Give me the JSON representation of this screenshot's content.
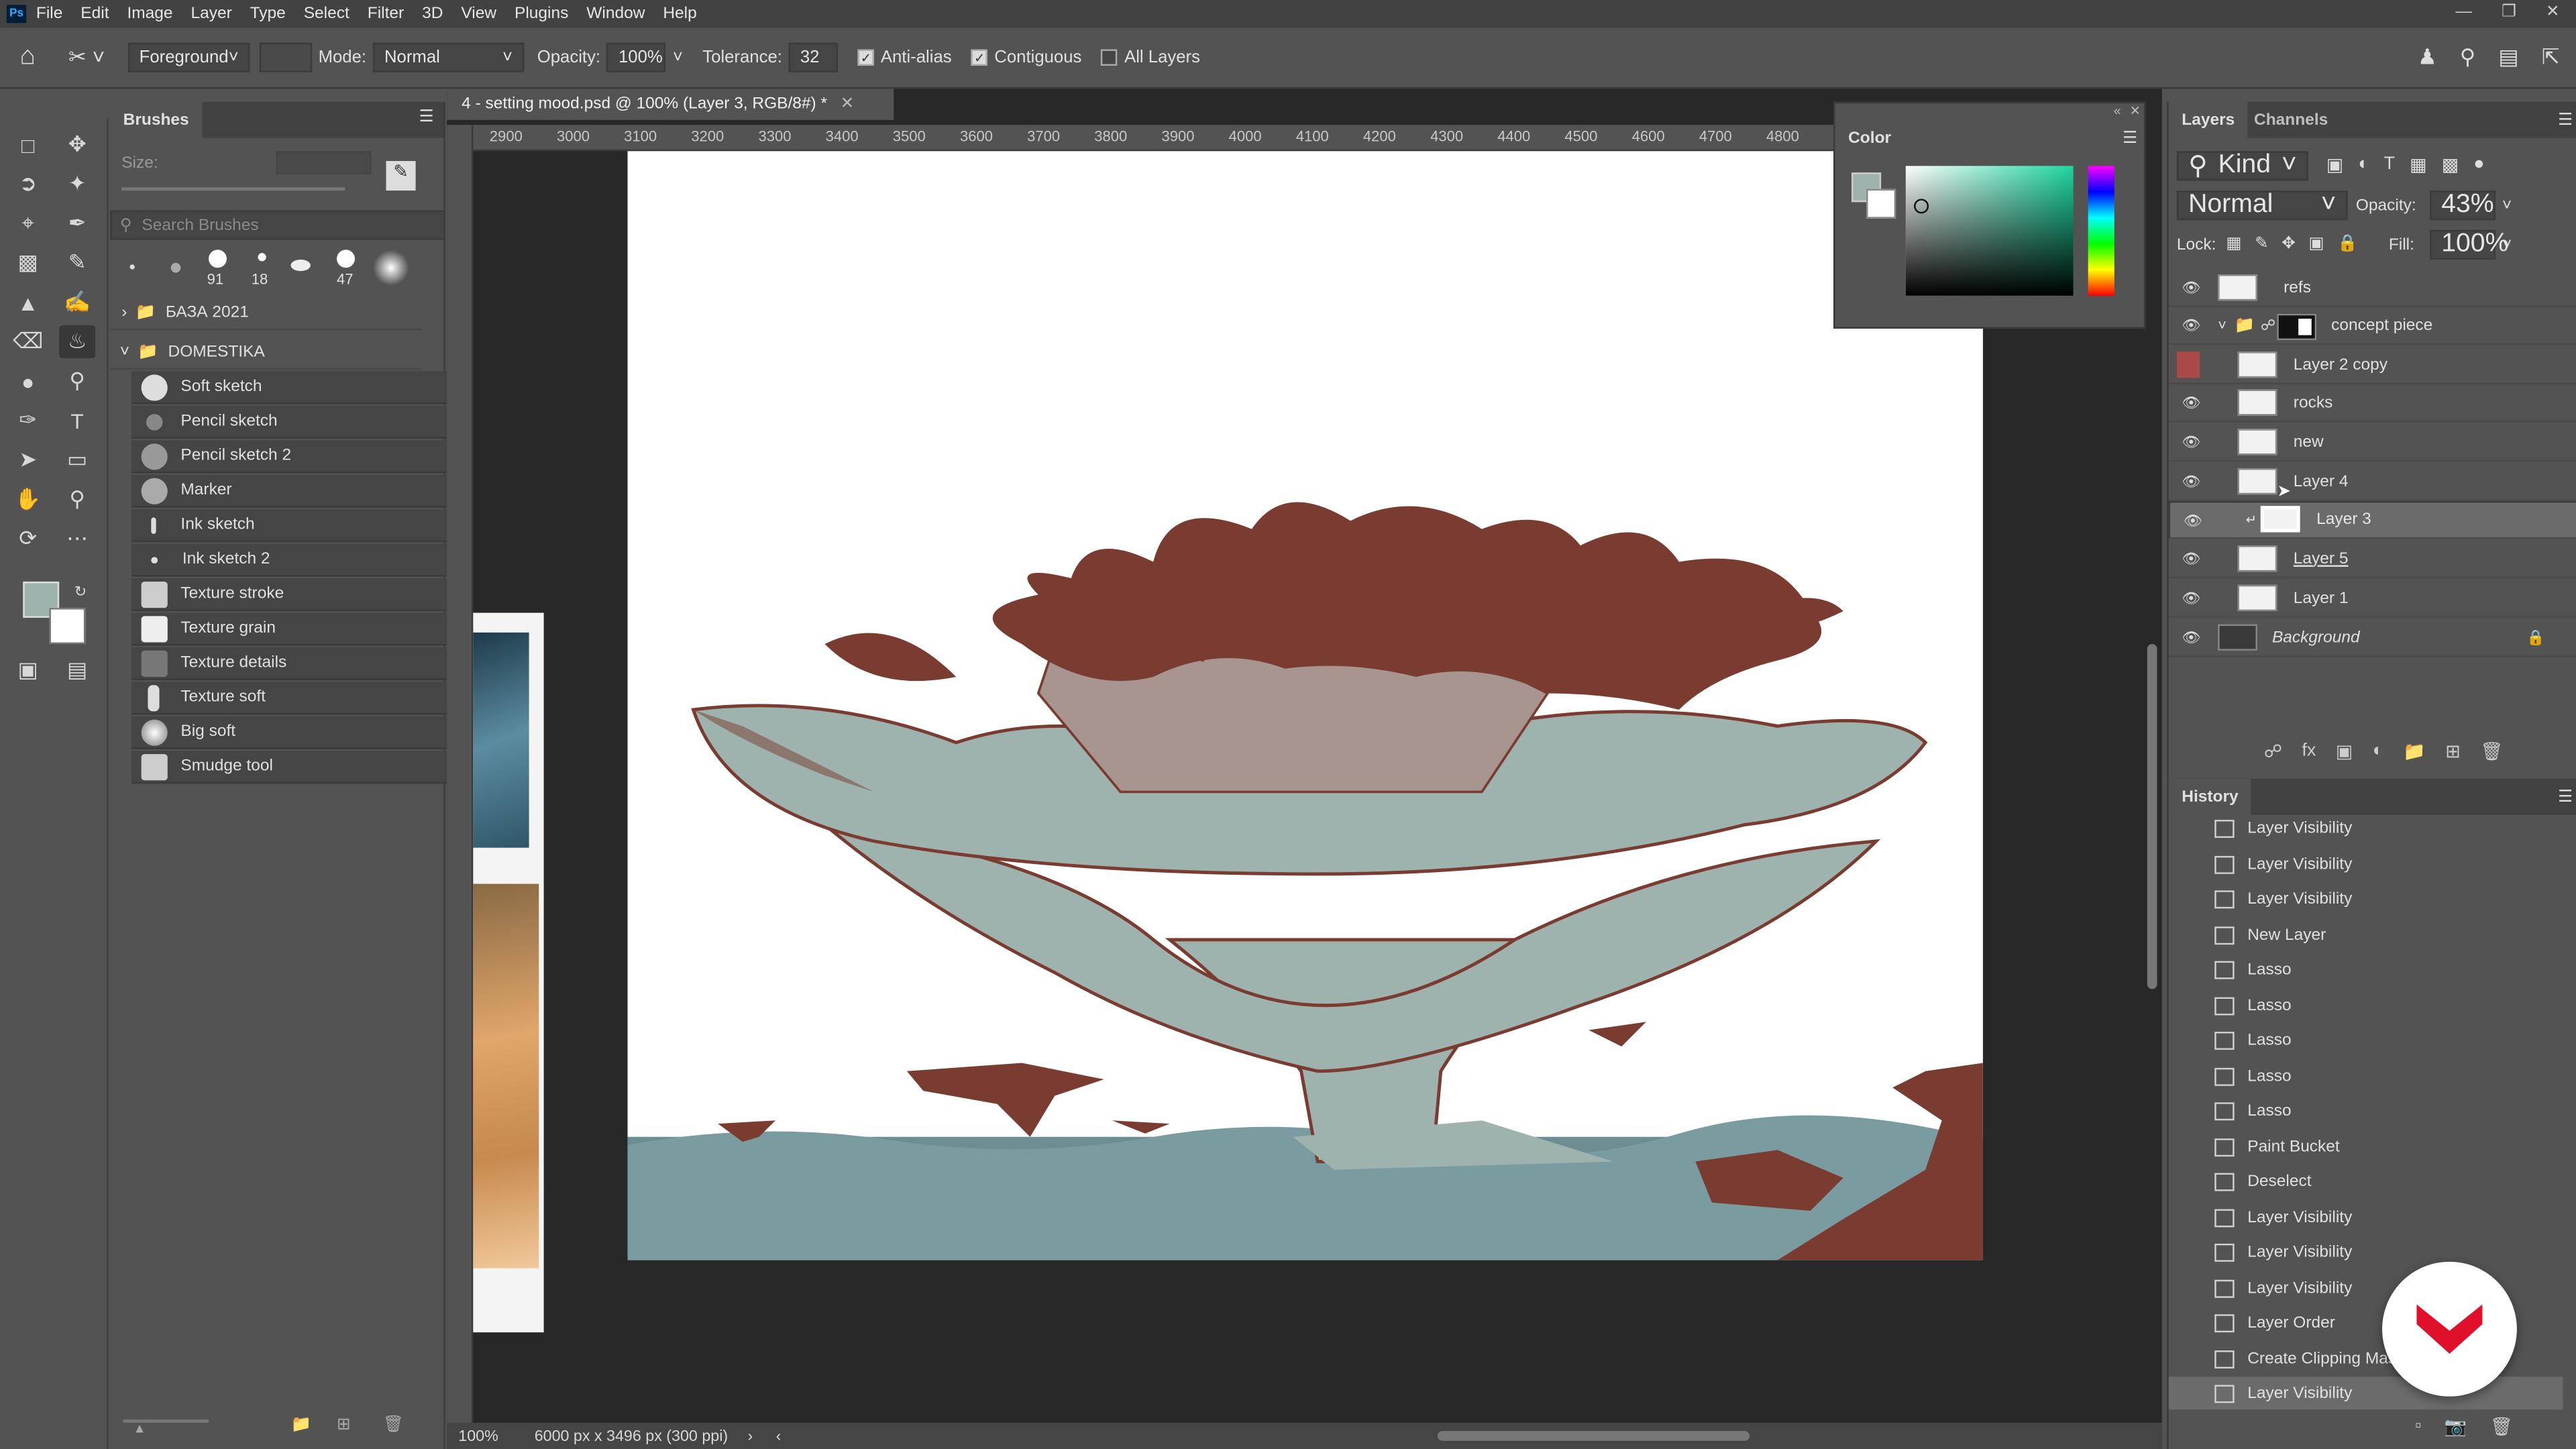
{
  "menu": {
    "app_icon": "Ps",
    "items": [
      "File",
      "Edit",
      "Image",
      "Layer",
      "Type",
      "Select",
      "Filter",
      "3D",
      "View",
      "Plugins",
      "Window",
      "Help"
    ]
  },
  "options": {
    "fill_source": "Foreground",
    "mode_label": "Mode:",
    "mode_value": "Normal",
    "opacity_label": "Opacity:",
    "opacity_value": "100%",
    "tolerance_label": "Tolerance:",
    "tolerance_value": "32",
    "anti_alias": "Anti-alias",
    "contiguous": "Contiguous",
    "all_layers": "All Layers"
  },
  "brushes": {
    "title": "Brushes",
    "size_label": "Size:",
    "search_placeholder": "Search Brushes",
    "presets": [
      "91",
      "18",
      "47"
    ],
    "group1": "БАЗА 2021",
    "group2": "DOMESTIKA",
    "items": [
      "Soft sketch",
      "Pencil sketch",
      "Pencil sketch 2",
      "Marker",
      "Ink sketch",
      "Ink sketch 2",
      "Texture stroke",
      "Texture grain",
      "Texture details",
      "Texture soft",
      "Big soft",
      "Smudge tool"
    ]
  },
  "document": {
    "tab_title": "4 - setting mood.psd @ 100% (Layer 3, RGB/8#) *",
    "ruler_ticks": [
      "2900",
      "3000",
      "3100",
      "3200",
      "3300",
      "3400",
      "3500",
      "3600",
      "3700",
      "3800",
      "3900",
      "4000",
      "4100",
      "4200",
      "4300",
      "4400",
      "4500",
      "4600",
      "4700",
      "4800"
    ],
    "zoom": "100%",
    "doc_info": "6000 px x 3496 px (300 ppi)"
  },
  "color_panel": {
    "title": "Color"
  },
  "layers_panel": {
    "tab_layers": "Layers",
    "tab_channels": "Channels",
    "filter_kind": "Kind",
    "blend_mode": "Normal",
    "opacity_label": "Opacity:",
    "opacity_value": "43%",
    "lock_label": "Lock:",
    "fill_label": "Fill:",
    "fill_value": "100%",
    "layers": [
      "refs",
      "concept piece",
      "Layer 2 copy",
      "rocks",
      "new",
      "Layer 4",
      "Layer 3",
      "Layer 5",
      "Layer 1",
      "Background"
    ]
  },
  "history_panel": {
    "title": "History",
    "items": [
      "Layer Visibility",
      "Layer Visibility",
      "Layer Visibility",
      "New Layer",
      "Lasso",
      "Lasso",
      "Lasso",
      "Lasso",
      "Lasso",
      "Paint Bucket",
      "Deselect",
      "Layer Visibility",
      "Layer Visibility",
      "Layer Visibility",
      "Layer Order",
      "Create Clipping Mas",
      "Layer Visibility"
    ]
  },
  "colors": {
    "accent_red": "#7a3b30",
    "sage": "#9fb3ae",
    "water": "#6d8d92",
    "domestika_red": "#e0102a"
  }
}
